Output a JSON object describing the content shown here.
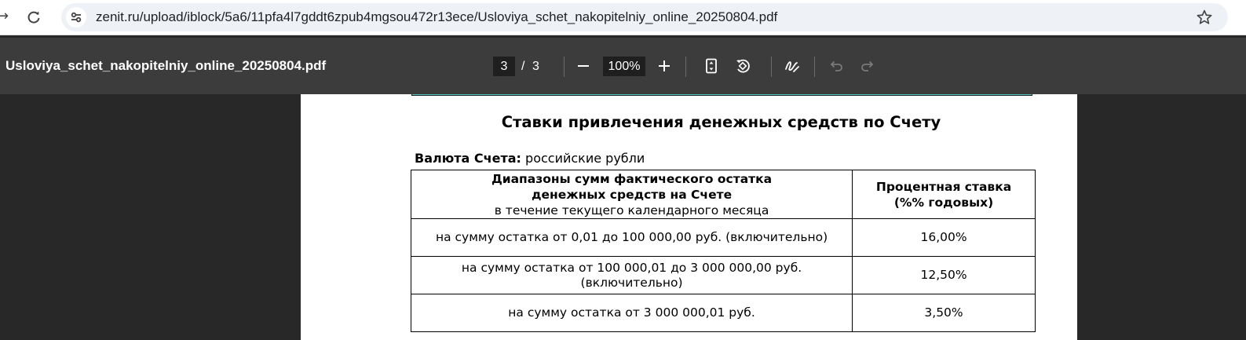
{
  "browser": {
    "url": "zenit.ru/upload/iblock/5a6/11pfa4l7gddt6zpub4mgsou472r13ece/Usloviya_schet_nakopitelniy_online_20250804.pdf"
  },
  "pdf_toolbar": {
    "title": "Usloviya_schet_nakopitelniy_online_20250804.pdf",
    "current_page": "3",
    "page_separator": "/",
    "total_pages": "3",
    "zoom": "100%"
  },
  "document": {
    "heading": "Ставки привлечения денежных средств по Счету",
    "currency_label": "Валюта Счета:",
    "currency_value": "российские рубли",
    "table": {
      "header_col1_line1": "Диапазоны сумм фактического остатка",
      "header_col1_line2": "денежных средств на Счете",
      "header_col1_line3": "в течение текущего календарного месяца",
      "header_col2_line1": "Процентная ставка",
      "header_col2_line2": "(%% годовых)",
      "rows": [
        {
          "range": "на сумму остатка от 0,01 до 100 000,00 руб. (включительно)",
          "rate": "16,00%"
        },
        {
          "range_line1": "на сумму остатка от 100 000,01 до 3 000 000,00 руб.",
          "range_line2": "(включительно)",
          "rate": "12,50%"
        },
        {
          "range": "на сумму остатка от 3 000 000,01 руб.",
          "rate": "3,50%"
        }
      ]
    }
  },
  "icons": {
    "back": "back-arrow-icon",
    "reload": "reload-icon",
    "site_info": "tune-icon",
    "bookmark": "star-icon",
    "zoom_out": "minus-icon",
    "zoom_in": "plus-icon",
    "fit": "fit-page-icon",
    "rotate": "rotate-icon",
    "annotate": "draw-icon",
    "undo": "undo-icon",
    "redo": "redo-icon"
  }
}
